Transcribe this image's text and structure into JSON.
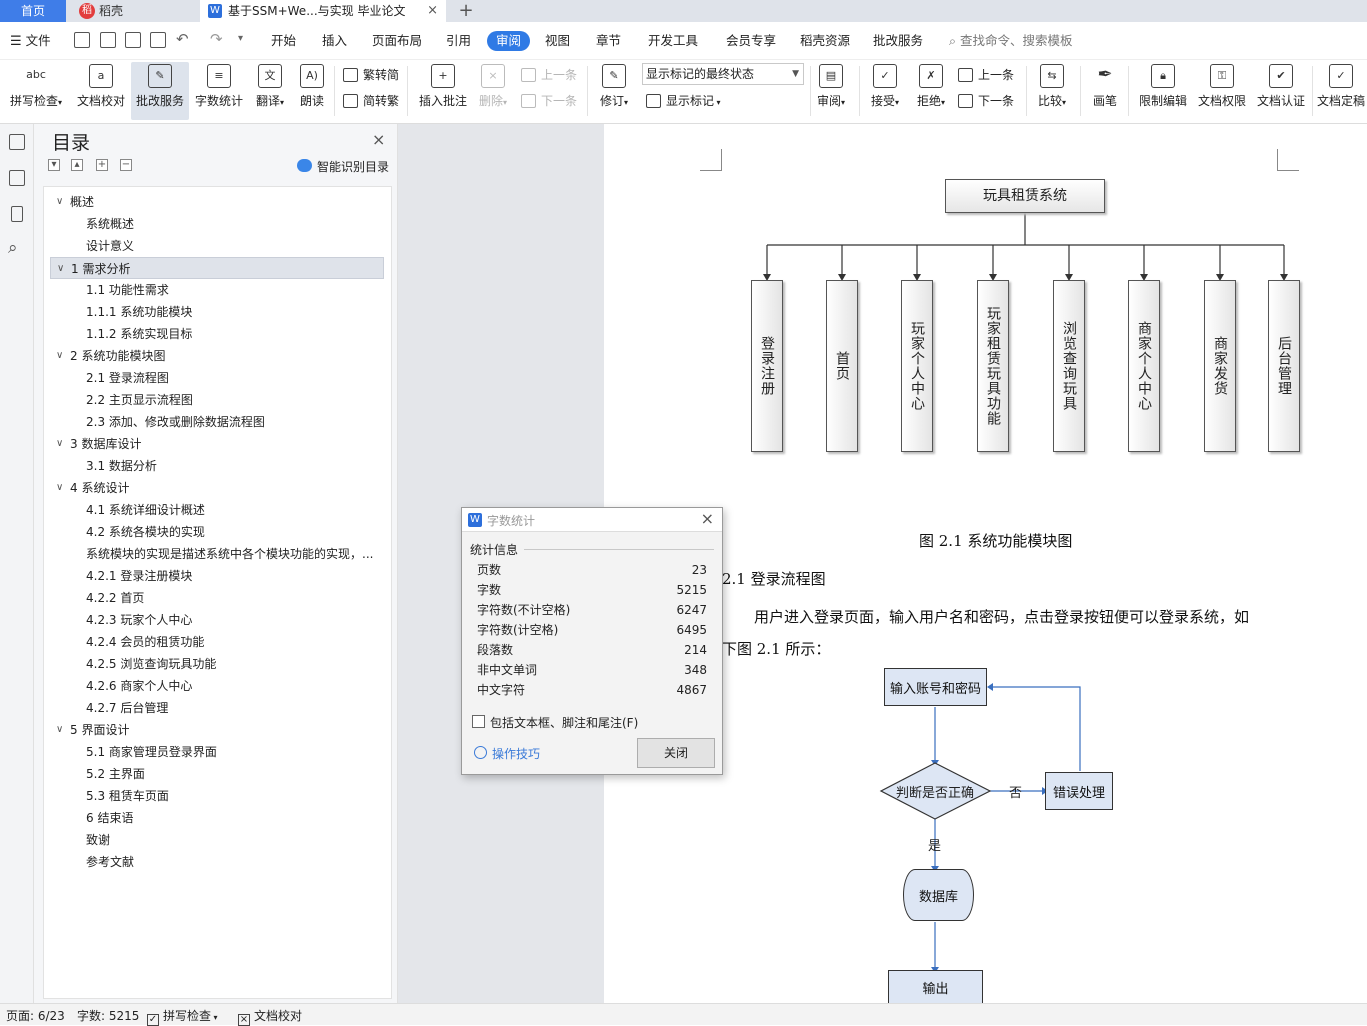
{
  "tabs": {
    "home": "首页",
    "daoke": "稻壳",
    "doc": "基于SSM+We...与实现 毕业论文",
    "close": "×",
    "add": "+"
  },
  "menu": {
    "file": "文件",
    "items": [
      "开始",
      "插入",
      "页面布局",
      "引用",
      "审阅",
      "视图",
      "章节",
      "开发工具",
      "会员专享",
      "稻壳资源",
      "批改服务"
    ],
    "active": "审阅",
    "search_placeholder": "查找命令、搜索模板"
  },
  "ribbon": {
    "spell": "拼写检查",
    "proofread": "文档校对",
    "correction": "批改服务",
    "wordcount": "字数统计",
    "translate": "翻译",
    "readaloud": "朗读",
    "trad_to_simp": "繁转简",
    "simp_to_trad": "简转繁",
    "insert_comment": "插入批注",
    "delete": "删除",
    "prev_comment": "上一条",
    "next_comment": "下一条",
    "revise": "修订",
    "markup_state": "显示标记的最终状态",
    "show_markup": "显示标记",
    "review": "审阅",
    "accept": "接受",
    "reject": "拒绝",
    "prev_change": "上一条",
    "next_change": "下一条",
    "compare": "比较",
    "pen": "画笔",
    "restrict": "限制编辑",
    "permission": "文档权限",
    "certify": "文档认证",
    "finalize": "文档定稿"
  },
  "nav": {
    "title": "目录",
    "smart_toc": "智能识别目录",
    "items": [
      {
        "label": "概述",
        "level": 0,
        "caret": "∨"
      },
      {
        "label": "系统概述",
        "level": 1
      },
      {
        "label": "设计意义",
        "level": 1
      },
      {
        "label": "1  需求分析",
        "level": 0,
        "caret": "∨",
        "selected": true
      },
      {
        "label": "1.1  功能性需求",
        "level": 1
      },
      {
        "label": "1.1.1  系统功能模块",
        "level": 1
      },
      {
        "label": "1.1.2  系统实现目标",
        "level": 1
      },
      {
        "label": "2  系统功能模块图",
        "level": 0,
        "caret": "∨"
      },
      {
        "label": "2.1  登录流程图",
        "level": 1
      },
      {
        "label": "2.2  主页显示流程图",
        "level": 1
      },
      {
        "label": "2.3  添加、修改或删除数据流程图",
        "level": 1
      },
      {
        "label": "3  数据库设计",
        "level": 0,
        "caret": "∨"
      },
      {
        "label": "3.1  数据分析",
        "level": 1
      },
      {
        "label": "4  系统设计",
        "level": 0,
        "caret": "∨"
      },
      {
        "label": "4.1  系统详细设计概述",
        "level": 1
      },
      {
        "label": "4.2 系统各模块的实现",
        "level": 1
      },
      {
        "label": "系统模块的实现是描述系统中各个模块功能的实现，...",
        "level": 1
      },
      {
        "label": "4.2.1  登录注册模块",
        "level": 1
      },
      {
        "label": "4.2.2  首页",
        "level": 1
      },
      {
        "label": "4.2.3  玩家个人中心",
        "level": 1
      },
      {
        "label": "4.2.4  会员的租赁功能",
        "level": 1
      },
      {
        "label": "4.2.5  浏览查询玩具功能",
        "level": 1
      },
      {
        "label": "4.2.6  商家个人中心",
        "level": 1
      },
      {
        "label": "4.2.7  后台管理",
        "level": 1
      },
      {
        "label": "5  界面设计",
        "level": 0,
        "caret": "∨"
      },
      {
        "label": "5.1  商家管理员登录界面",
        "level": 1
      },
      {
        "label": "5.2  主界面",
        "level": 1
      },
      {
        "label": "5.3  租赁车页面",
        "level": 1
      },
      {
        "label": "6  结束语",
        "level": 1
      },
      {
        "label": "致谢",
        "level": 1
      },
      {
        "label": "参考文献",
        "level": 1
      }
    ]
  },
  "doc": {
    "tree_root": "玩具租赁系统",
    "tree_children": [
      "登录注册",
      "首页",
      "玩家个人中心",
      "玩家租赁玩具功能",
      "浏览查询玩具",
      "商家个人中心",
      "商家发货",
      "后台管理"
    ],
    "figure_caption": "图 2.1 系统功能模块图",
    "section_heading": "2.1  登录流程图",
    "paragraph_line1": "用户进入登录页面，输入用户名和密码，点击登录按钮便可以登录系统，如",
    "paragraph_line2": "下图 2.1 所示：",
    "flow": {
      "input": "输入账号和密码",
      "decision": "判断是否正确",
      "no": "否",
      "yes": "是",
      "error": "错误处理",
      "db": "数据库",
      "output": "输出"
    }
  },
  "dialog": {
    "title": "字数统计",
    "group": "统计信息",
    "stats": [
      {
        "label": "页数",
        "value": "23"
      },
      {
        "label": "字数",
        "value": "5215"
      },
      {
        "label": "字符数(不计空格)",
        "value": "6247"
      },
      {
        "label": "字符数(计空格)",
        "value": "6495"
      },
      {
        "label": "段落数",
        "value": "214"
      },
      {
        "label": "非中文单词",
        "value": "348"
      },
      {
        "label": "中文字符",
        "value": "4867"
      }
    ],
    "checkbox": "包括文本框、脚注和尾注(F)",
    "tips": "操作技巧",
    "close": "关闭"
  },
  "status": {
    "page": "页面: 6/23",
    "words": "字数: 5215",
    "spell": "拼写检查",
    "proof": "文档校对"
  },
  "colors": {
    "accent": "#2f7ae5",
    "tab_home": "#3f7de8",
    "flow_fill": "#dde6f4"
  }
}
